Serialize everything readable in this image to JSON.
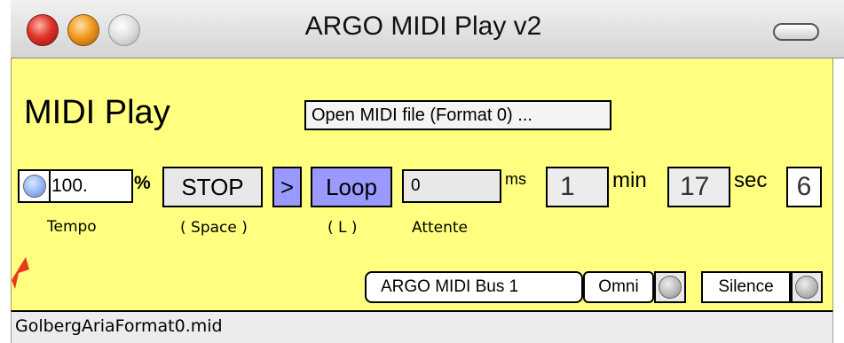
{
  "window": {
    "title": "ARGO MIDI Play v2"
  },
  "main": {
    "heading": "MIDI Play",
    "open_button_label": "Open MIDI file (Format 0) ...",
    "tempo": {
      "value": "100.",
      "unit": "%",
      "caption": "Tempo"
    },
    "transport": {
      "stop_label": "STOP",
      "stop_caption": "( Space )",
      "play_label": ">",
      "loop_label": "Loop",
      "loop_caption": "( L )"
    },
    "wait": {
      "value": "0",
      "unit": "ms",
      "caption": "Attente"
    },
    "time": {
      "minutes": "1",
      "minutes_unit": "min",
      "seconds": "17",
      "seconds_unit": "sec",
      "extra": "6"
    },
    "midi": {
      "bus_label": "ARGO MIDI Bus 1",
      "omni_label": "Omni",
      "silence_label": "Silence"
    }
  },
  "status": {
    "filename": "GolbergAriaFormat0.mid"
  },
  "colors": {
    "panel_background": "#ffff80",
    "transport_accent": "#9999ff",
    "tempo_dial": "#8bb0f0"
  }
}
